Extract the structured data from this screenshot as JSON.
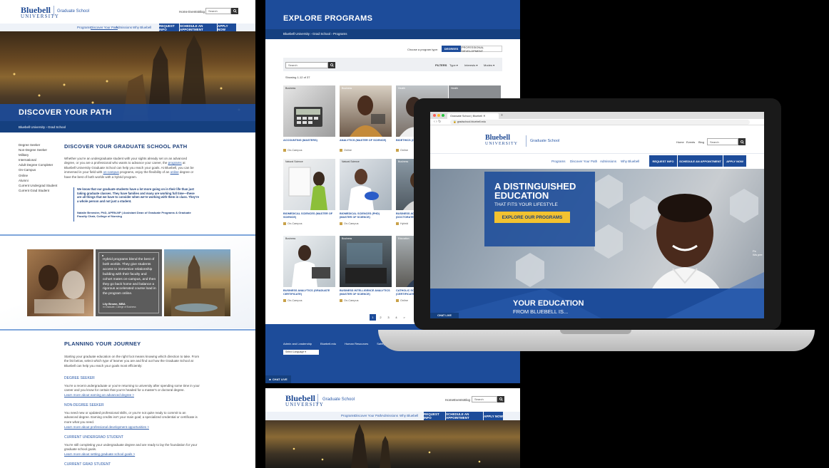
{
  "brand": {
    "line1": "Bluebell",
    "line2": "UNIVERSITY",
    "school": "Graduate School"
  },
  "util": {
    "home": "Home",
    "events": "Events",
    "blog": "Blog",
    "search_placeholder": "Search"
  },
  "nav": {
    "programs": "Programs",
    "discover": "Discover Your Path",
    "admissions": "Admissions",
    "why": "Why Bluebell"
  },
  "cta": {
    "request": "REQUEST INFO",
    "schedule": "SCHEDULE AN APPOINTMENT",
    "apply": "APPLY NOW"
  },
  "panelA": {
    "hero_title": "DISCOVER YOUR PATH",
    "breadcrumb": [
      "Bluebell University",
      "Grad School"
    ],
    "sidenav": [
      "Degree Seeker",
      "Non-Degree Seeker",
      "Military",
      "International",
      "Adult Degree Completer",
      "On-Campus",
      "Online",
      "Alumni",
      "Current Undergrad Student",
      "Current Grad Student"
    ],
    "section_title": "DISCOVER YOUR GRADUATE SCHOOL PATH",
    "intro_pre": "Whether you're an undergraduate student with your sights already set on an advanced degree, or you are a professional who wants to advance your career, the ",
    "intro_link1": "programs",
    "intro_mid": " at Bluebell University Graduate School can help you reach your goals. At Bluebell, you can be immersed in your field with ",
    "intro_link2": "on-campus",
    "intro_mid2": " programs, enjoy the flexibility of an ",
    "intro_link3": "online",
    "intro_post": " degree or have the best of both worlds with a hybrid program.",
    "quote": "We know that our graduate students have a lot more going on in their life than just taking graduate classes. They have families and many are working full time—these are all things that we have to consider when we're working with them in class. They're a whole person and not just a student.",
    "quote_author": "Natalie Brewster, PhD, APRN-NP | Assistant Dean of Graduate Programs & Graduate Faculty Chair, College of Nursing",
    "hybrid_quote": "Hybrid programs blend the best of both worlds. They give students access to immersive relationship building with their faculty and cohort mates on-campus, and then they go back home and balance a rigorous accelerated course load in the program online.",
    "hybrid_author": "Lily Brown, MBA",
    "hybrid_author_sub": "in Graduate, College of Business",
    "journey_title": "PLANNING YOUR JOURNEY",
    "journey_intro": "Starting your graduate education on the right foot means knowing which direction to take. From the list below, select which type of learner you are and find out how the Graduate School at Bluebell can help you reach your goals most efficiently:",
    "sections": [
      {
        "title": "DEGREE SEEKER",
        "text": "You're a recent undergraduate or you're returning to university after spending some time in your career and you know for certain that you're headed for a master's or doctoral degree.",
        "link": "Learn more about earning an advanced degree >"
      },
      {
        "title": "NON-DEGREE SEEKER",
        "text": "You need new or updated professional skills, or you're not quite ready to commit to an advanced degree. Earning credits isn't your main goal; a specialized credential or certificate is more what you need.",
        "link": "Learn more about professional development opportunities >"
      },
      {
        "title": "CURRENT UNDERGRAD STUDENT",
        "text": "You're still completing your undergraduate degree and are ready to lay the foundation for your graduate school goals.",
        "link": "Learn more about setting graduate school goals >"
      },
      {
        "title": "CURRENT GRAD STUDENT",
        "text": "",
        "link": ""
      }
    ]
  },
  "panelB": {
    "title": "EXPLORE PROGRAMS",
    "breadcrumb": [
      "Bluebell University",
      "Grad School",
      "Programs"
    ],
    "choose_label": "Choose a program type:",
    "type_options": [
      "DEGREES",
      "PROFESSIONAL DEVELOPMENT"
    ],
    "search_placeholder": "Search",
    "filters_label": "FILTERS",
    "filters": [
      "Type",
      "Interests",
      "Modes"
    ],
    "showing": "Showing 1-12 of 37",
    "cards": [
      {
        "cat": "Business",
        "title": "ACCOUNTING (MASTERS)",
        "mode": "On-Campus"
      },
      {
        "cat": "Business",
        "title": "ANALYTICS (MASTER OF SCIENCE)",
        "mode": "Online"
      },
      {
        "cat": "Health",
        "title": "BIOETHICS (CERTIFICATE)",
        "mode": "Online"
      },
      {
        "cat": "Health",
        "title": "",
        "mode": ""
      },
      {
        "cat": "Natural Science",
        "title": "BIOMEDICAL SCIENCES (MASTER OF SCIENCE)",
        "mode": "On-Campus"
      },
      {
        "cat": "Natural Science",
        "title": "BIOMEDICAL SCIENCES (PHD) (MASTER OF SCIENCE)",
        "mode": "On-Campus"
      },
      {
        "cat": "Business",
        "title": "BUSINESS ADMINISTRATION (DOCTORATE)",
        "mode": "Hybrid"
      },
      {
        "cat": "Business",
        "title": "BUSINESS ANALYTICS (GRADUATE CERTIFICATE)",
        "mode": "On-Campus"
      },
      {
        "cat": "Business",
        "title": "BUSINESS INTELLIGENCE ANALYTICS (MASTER OF SCIENCE)",
        "mode": "On-Campus"
      },
      {
        "cat": "Education",
        "title": "CATHOLIC SCHOOL LEADERSHIP (CERTIFICATE)",
        "mode": "Online"
      }
    ],
    "pages": [
      "1",
      "2",
      "3",
      "4",
      ">"
    ],
    "footer_links": [
      "Admin and Leadership",
      "Bluebell.edu",
      "Human Resources",
      "Safety"
    ],
    "language": "Select Language",
    "chat": "CHAT LIVE"
  },
  "laptop": {
    "tab": "Graduate School | Bluebell",
    "url": "gradschool.bluebell.edu",
    "hero_line1": "A DISTINGUISHED",
    "hero_line2": "EDUCATION",
    "hero_sub": "THAT FITS YOUR LIFESTYLE",
    "hero_cta": "EXPLORE OUR PROGRAMS",
    "side_text1": "Pe",
    "side_text2": "Wa pee",
    "band_title": "YOUR EDUCATION",
    "band_sub": "FROM BLUEBELL IS...",
    "chat": "CHAT LIVE"
  },
  "colors": {
    "brand": "#1d4c9a",
    "navy": "#1d3f7a",
    "gold": "#f2c230",
    "light_blue": "#6fa0dc"
  }
}
